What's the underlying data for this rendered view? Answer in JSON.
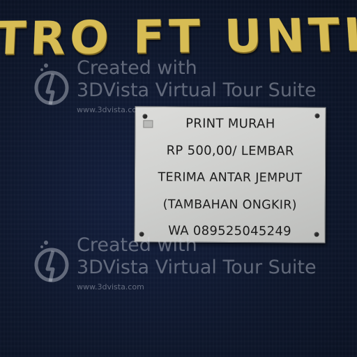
{
  "scene": {
    "wall_lettering": "TRO FT UNTIE",
    "lettering_color": "#d7bc54",
    "wall_color": "#0f1830"
  },
  "sign": {
    "lines": [
      "PRINT MURAH",
      "RP 500,00/ LEMBAR",
      "TERIMA ANTAR JEMPUT",
      "(TAMBAHAN ONGKIR)",
      "WA 089525045249"
    ]
  },
  "watermark": {
    "line1": "Created with",
    "line2": "3DVista Virtual Tour Suite",
    "url": "www.3dvista.com",
    "logo_icon": "3dvista-logo-icon"
  }
}
